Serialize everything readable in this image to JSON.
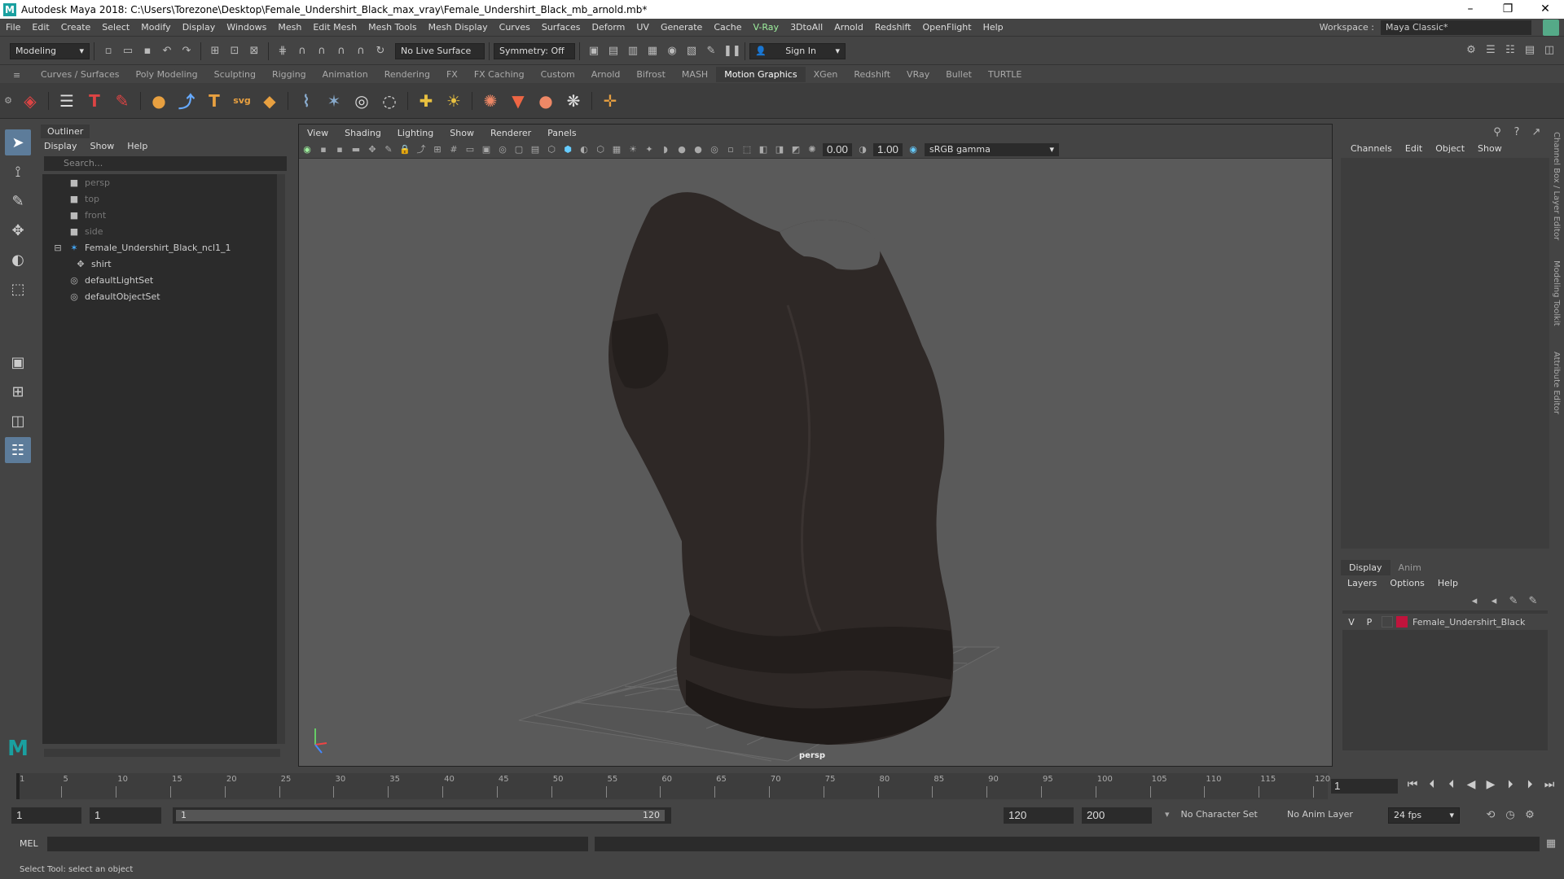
{
  "titlebar": {
    "title": "Autodesk Maya 2018: C:\\Users\\Torezone\\Desktop\\Female_Undershirt_Black_max_vray\\Female_Undershirt_Black_mb_arnold.mb*",
    "logo": "M",
    "minimize": "–",
    "maximize": "❐",
    "close": "✕"
  },
  "menubar": {
    "items": [
      "File",
      "Edit",
      "Create",
      "Select",
      "Modify",
      "Display",
      "Windows",
      "Mesh",
      "Edit Mesh",
      "Mesh Tools",
      "Mesh Display",
      "Curves",
      "Surfaces",
      "Deform",
      "UV",
      "Generate",
      "Cache",
      "V-Ray",
      "3DtoAll",
      "Arnold",
      "Redshift",
      "OpenFlight",
      "Help"
    ],
    "workspace_label": "Workspace :",
    "workspace_value": "Maya Classic*"
  },
  "statusline": {
    "mode": "Modeling",
    "live_surface": "No Live Surface",
    "symmetry": "Symmetry: Off",
    "sign_in": "Sign In"
  },
  "shelf": {
    "tabs": [
      "Curves / Surfaces",
      "Poly Modeling",
      "Sculpting",
      "Rigging",
      "Animation",
      "Rendering",
      "FX",
      "FX Caching",
      "Custom",
      "Arnold",
      "Bifrost",
      "MASH",
      "Motion Graphics",
      "XGen",
      "Redshift",
      "VRay",
      "Bullet",
      "TURTLE"
    ],
    "active_tab": "Motion Graphics"
  },
  "outliner": {
    "title": "Outliner",
    "menu": [
      "Display",
      "Show",
      "Help"
    ],
    "search_placeholder": "Search...",
    "items": [
      {
        "label": "persp",
        "icon": "camera-icon"
      },
      {
        "label": "top",
        "icon": "camera-icon"
      },
      {
        "label": "front",
        "icon": "camera-icon"
      },
      {
        "label": "side",
        "icon": "camera-icon"
      },
      {
        "label": "Female_Undershirt_Black_ncl1_1",
        "icon": "group-icon"
      },
      {
        "label": "shirt",
        "icon": "mesh-icon"
      },
      {
        "label": "defaultLightSet",
        "icon": "set-icon"
      },
      {
        "label": "defaultObjectSet",
        "icon": "set-icon"
      }
    ]
  },
  "viewport": {
    "menu": [
      "View",
      "Shading",
      "Lighting",
      "Show",
      "Renderer",
      "Panels"
    ],
    "exposure": "0.00",
    "gamma": "1.00",
    "colorspace": "sRGB gamma",
    "camera_label": "persp"
  },
  "channelbox": {
    "menu": [
      "Channels",
      "Edit",
      "Object",
      "Show"
    ],
    "layer_tabs": [
      "Display",
      "Anim"
    ],
    "layer_menu": [
      "Layers",
      "Options",
      "Help"
    ],
    "layer": {
      "v": "V",
      "p": "P",
      "name": "Female_Undershirt_Black",
      "color": "#c0143c"
    },
    "side_tabs": [
      "Channel Box / Layer Editor",
      "Modeling Toolkit",
      "Attribute Editor"
    ]
  },
  "timeline": {
    "ticks": [
      "1",
      "5",
      "10",
      "15",
      "20",
      "25",
      "30",
      "35",
      "40",
      "45",
      "50",
      "55",
      "60",
      "65",
      "70",
      "75",
      "80",
      "85",
      "90",
      "95",
      "100",
      "105",
      "110",
      "115",
      "120"
    ],
    "current_frame": "1"
  },
  "range": {
    "start": "1",
    "anim_start": "1",
    "slider_start": "1",
    "slider_end": "120",
    "end": "120",
    "anim_end": "200",
    "character_set": "No Character Set",
    "anim_layer": "No Anim Layer",
    "fps": "24 fps"
  },
  "cmdline": {
    "label": "MEL"
  },
  "helpline": {
    "text": "Select Tool: select an object"
  }
}
